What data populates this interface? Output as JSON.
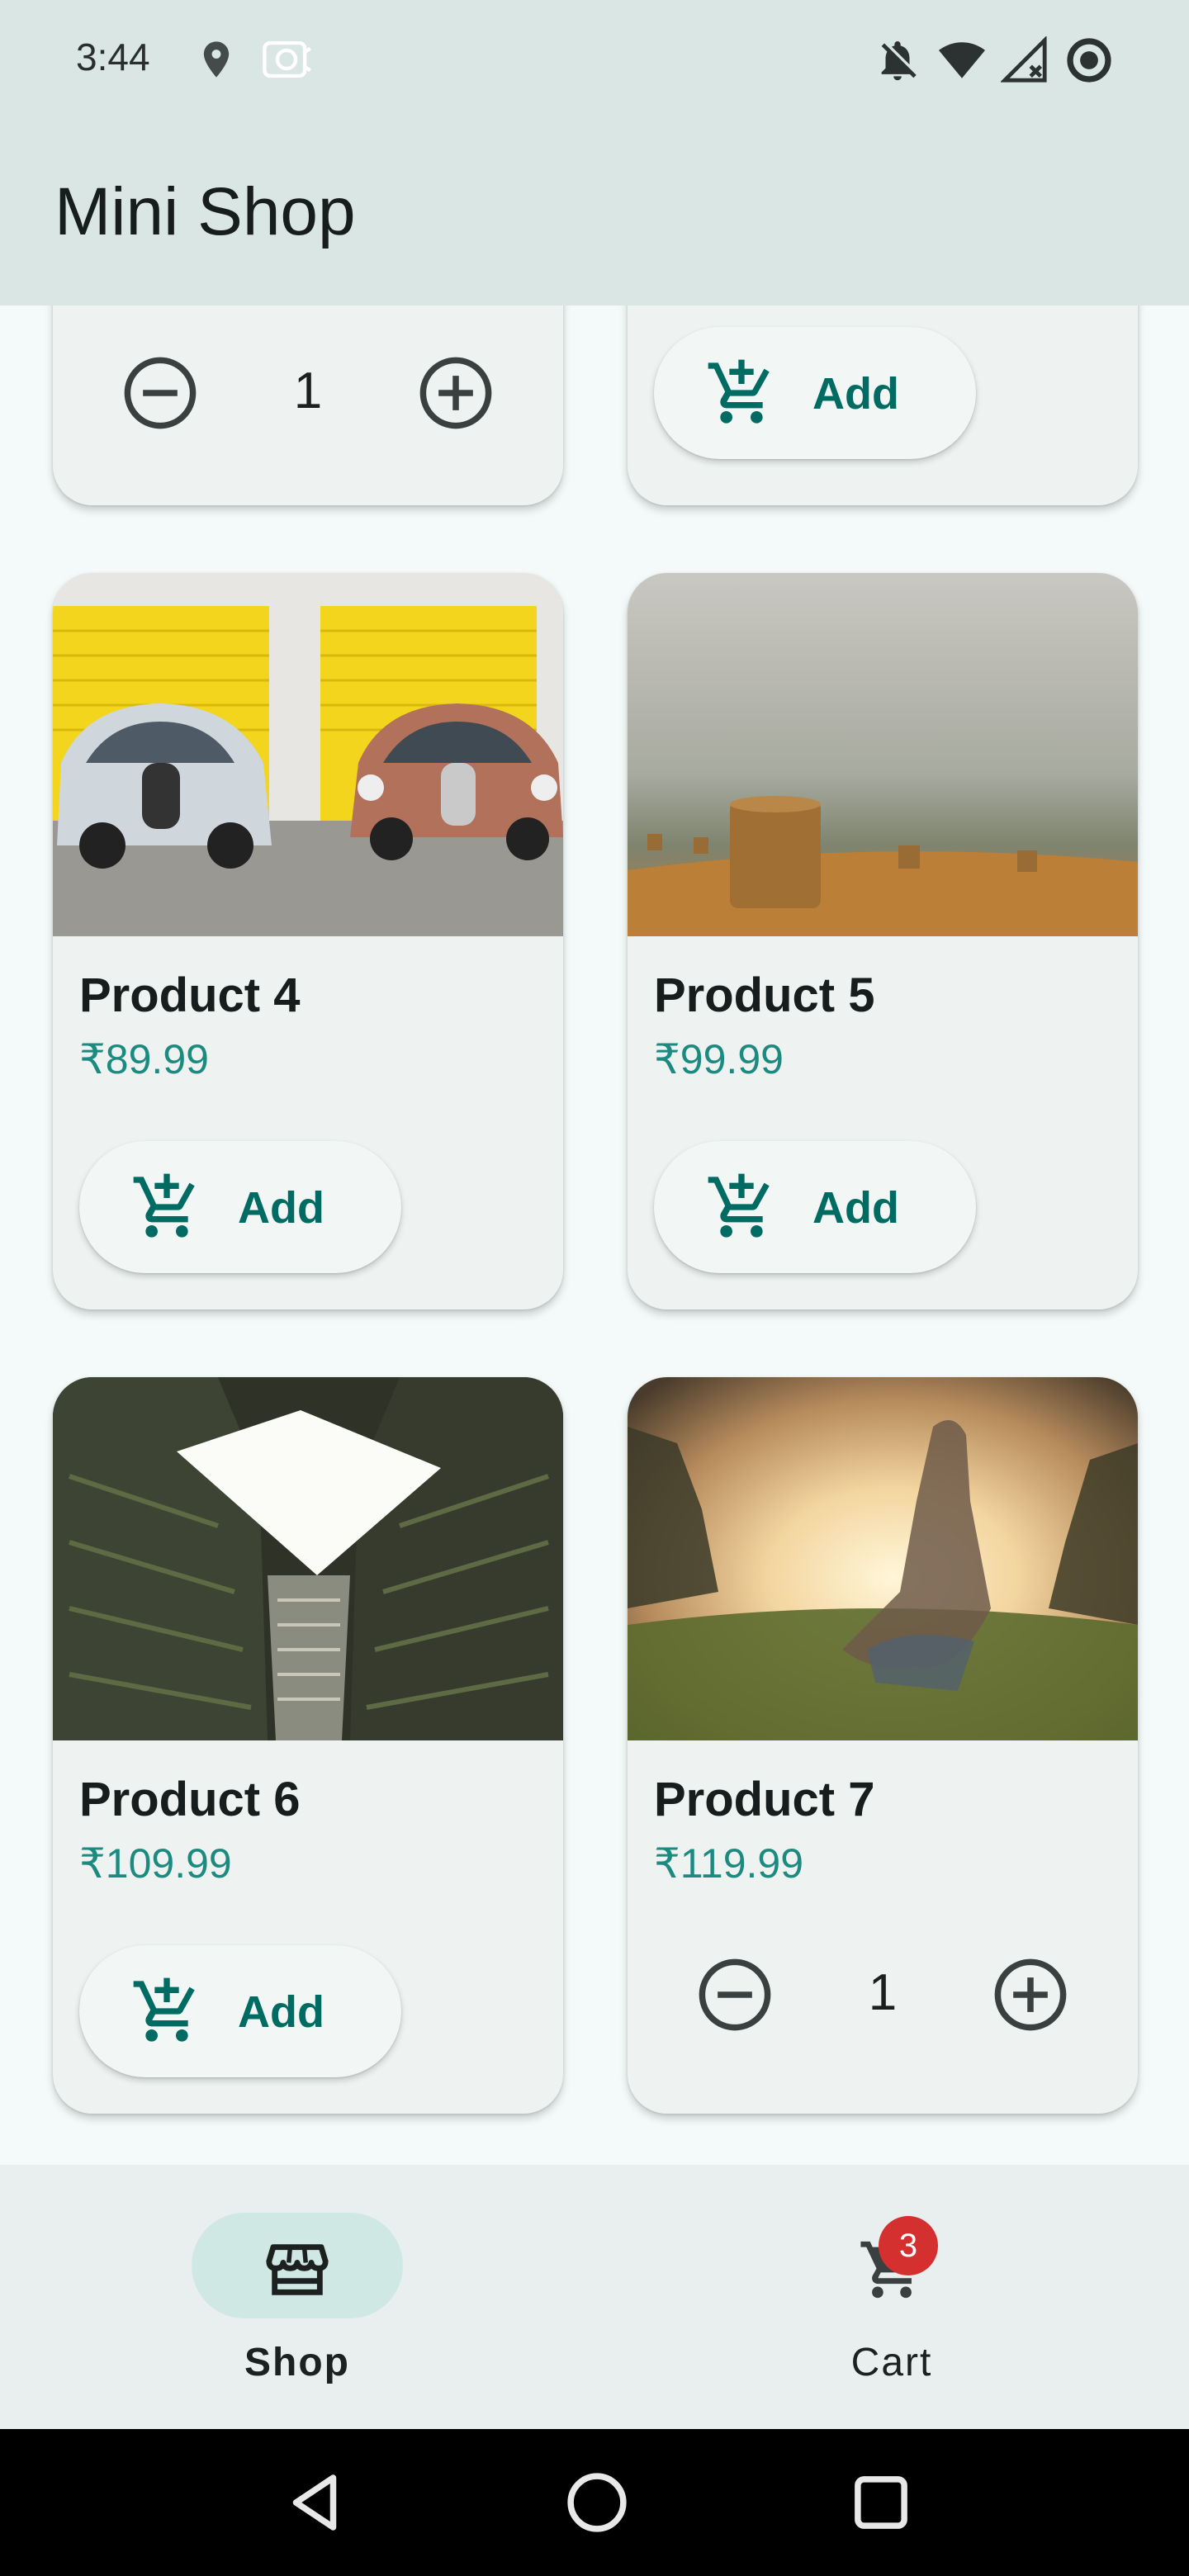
{
  "status_bar": {
    "time": "3:44",
    "left_icons": [
      "location-icon",
      "app-notification-icon"
    ],
    "right_icons": [
      "notifications-off-icon",
      "wifi-icon",
      "no-signal-icon",
      "data-saver-icon"
    ]
  },
  "app_bar": {
    "title": "Mini Shop"
  },
  "products": [
    {
      "id": "product-2",
      "state": "stepper",
      "quantity": "1"
    },
    {
      "id": "product-3",
      "state": "add",
      "add_label": "Add"
    },
    {
      "id": "product-4",
      "name": "Product 4",
      "price": "₹89.99",
      "state": "add",
      "add_label": "Add",
      "image": "vintage-cars-yellow-garage"
    },
    {
      "id": "product-5",
      "name": "Product 5",
      "price": "₹99.99",
      "state": "add",
      "add_label": "Add",
      "image": "hay-bales-foggy-field"
    },
    {
      "id": "product-6",
      "name": "Product 6",
      "price": "₹109.99",
      "state": "add",
      "add_label": "Add",
      "image": "building-courtyard-skyward"
    },
    {
      "id": "product-7",
      "name": "Product 7",
      "price": "₹119.99",
      "state": "stepper",
      "quantity": "1",
      "image": "girl-sunset-meadow"
    }
  ],
  "bottom_nav": {
    "items": [
      {
        "label": "Shop",
        "icon": "storefront-icon",
        "active": true
      },
      {
        "label": "Cart",
        "icon": "shopping-cart-icon",
        "badge": "3",
        "active": false
      }
    ]
  },
  "system_nav": {
    "buttons": [
      "back-icon",
      "home-icon",
      "recents-icon"
    ]
  },
  "colors": {
    "app_bar_bg": "#d9e6e4",
    "background": "#f4faf9",
    "card_bg": "#eef3f2",
    "price": "#1d8a80",
    "accent": "#006b63",
    "nav_pill": "#cfe8e4",
    "badge": "#d3302f"
  }
}
